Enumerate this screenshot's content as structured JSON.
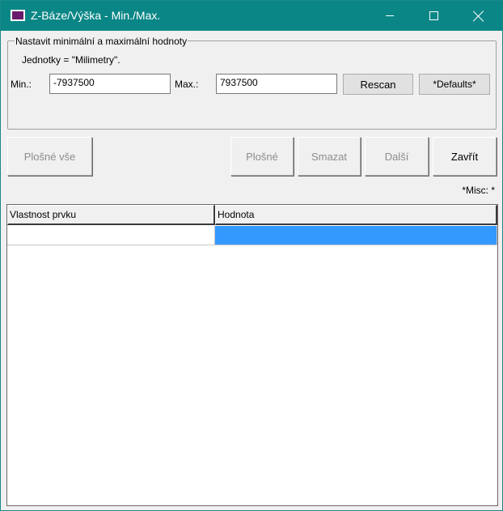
{
  "window": {
    "title": "Z-Báze/Výška - Min./Max."
  },
  "group": {
    "legend": "Nastavit minimální a maximální hodnoty",
    "units_text": "Jednotky = \"Milimetry\".",
    "min_label": "Min.:",
    "min_value": "-7937500",
    "max_label": "Max.:",
    "max_value": "7937500",
    "rescan_label": "Rescan",
    "defaults_label": "*Defaults*"
  },
  "buttons": {
    "plosne_vse": "Plošné vše",
    "plosne": "Plošné",
    "smazat": "Smazat",
    "dalsi": "Další",
    "zavrit": "Zavřít"
  },
  "misc_label": "*Misc: *",
  "grid": {
    "columns": [
      "Vlastnost prvku",
      "Hodnota"
    ],
    "rows": [
      {
        "property": "",
        "value": ""
      }
    ]
  },
  "colors": {
    "titlebar": "#0b8686",
    "selection": "#3399ff"
  }
}
